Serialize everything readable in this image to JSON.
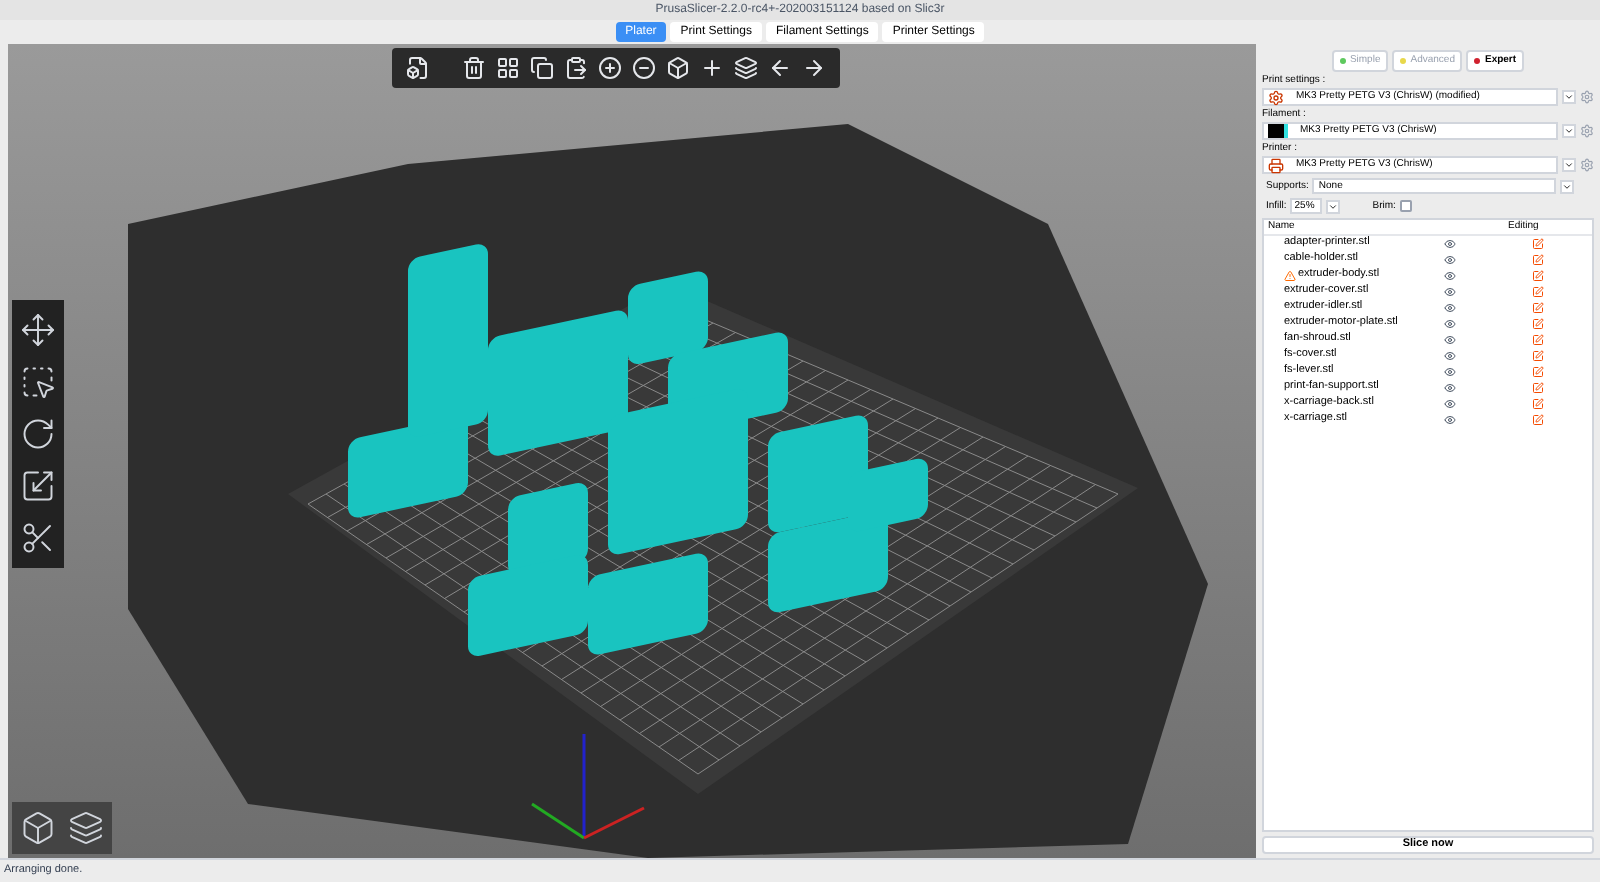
{
  "window": {
    "title": "PrusaSlicer-2.2.0-rc4+-202003151124 based on Slic3r"
  },
  "tabs": [
    {
      "label": "Plater",
      "selected": true
    },
    {
      "label": "Print Settings",
      "selected": false
    },
    {
      "label": "Filament Settings",
      "selected": false
    },
    {
      "label": "Printer Settings",
      "selected": false
    }
  ],
  "modes": [
    {
      "label": "Simple",
      "color": "#5ec95e",
      "selected": false
    },
    {
      "label": "Advanced",
      "color": "#e8d84a",
      "selected": false
    },
    {
      "label": "Expert",
      "color": "#d0212e",
      "selected": true
    }
  ],
  "presets": [
    {
      "kind": "print",
      "label": "Print settings :",
      "value": "MK3 Pretty PETG V3 (ChrisW) (modified)"
    },
    {
      "kind": "filament",
      "label": "Filament :",
      "value": "MK3 Pretty PETG V3 (ChrisW)"
    },
    {
      "kind": "printer",
      "label": "Printer :",
      "value": "MK3 Pretty PETG V3 (ChrisW)"
    }
  ],
  "supports": {
    "label": "Supports:",
    "value": "None"
  },
  "infill": {
    "label": "Infill:",
    "value": "25%"
  },
  "brim": {
    "label": "Brim:",
    "checked": false
  },
  "object_list": {
    "columns": [
      "Name",
      "Editing"
    ],
    "rows": [
      {
        "name": "adapter-printer.stl",
        "warning": false
      },
      {
        "name": "cable-holder.stl",
        "warning": false
      },
      {
        "name": "extruder-body.stl",
        "warning": true
      },
      {
        "name": "extruder-cover.stl",
        "warning": false
      },
      {
        "name": "extruder-idler.stl",
        "warning": false
      },
      {
        "name": "extruder-motor-plate.stl",
        "warning": false
      },
      {
        "name": "fan-shroud.stl",
        "warning": false
      },
      {
        "name": "fs-cover.stl",
        "warning": false
      },
      {
        "name": "fs-lever.stl",
        "warning": false
      },
      {
        "name": "print-fan-support.stl",
        "warning": false
      },
      {
        "name": "x-carriage-back.stl",
        "warning": false
      },
      {
        "name": "x-carriage.stl",
        "warning": false
      }
    ]
  },
  "slice_button": "Slice now",
  "status_bar": "Arranging done."
}
